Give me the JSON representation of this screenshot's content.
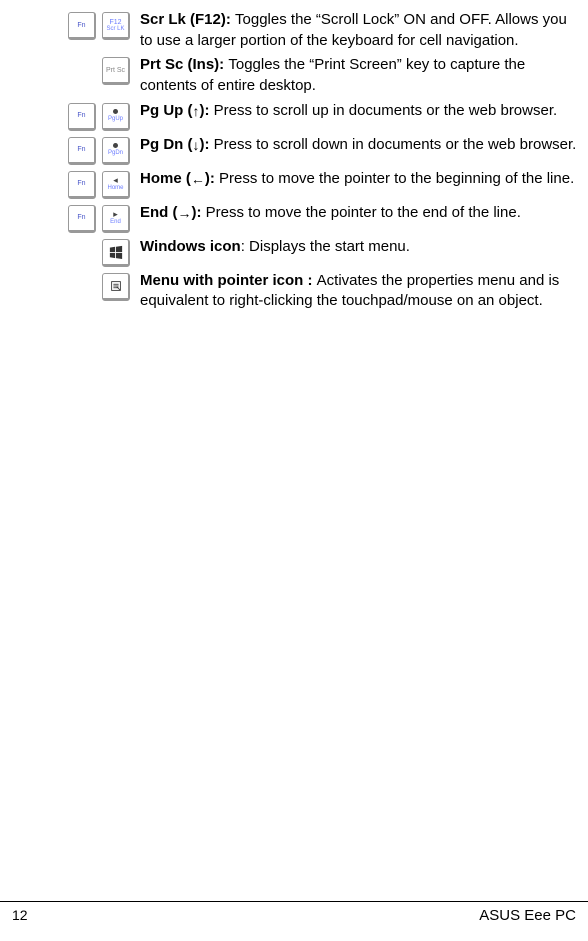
{
  "rows": [
    {
      "title": "Scr Lk (F12): ",
      "desc": "Toggles the “Scroll Lock” ON and OFF. Allows you to use a larger portion of the keyboard for cell navigation."
    },
    {
      "title": "Prt Sc (Ins): ",
      "desc": "Toggles the “Print Screen” key to capture the contents of entire desktop."
    },
    {
      "title_pre": "Pg Up (",
      "arrow": "↑",
      "title_post": "): ",
      "desc": "Press to scroll up in documents or the web browser."
    },
    {
      "title_pre": "Pg Dn (",
      "arrow": "↓",
      "title_post": "): ",
      "desc": "Press to scroll down in documents or the web browser."
    },
    {
      "title_pre": "Home (",
      "arrow": "←",
      "title_post": "): ",
      "desc": "Press to move the pointer to the beginning of the line."
    },
    {
      "title_pre": "End (",
      "arrow": "→",
      "title_post": "): ",
      "desc": "Press to move the pointer to the end of the line."
    },
    {
      "title": "Windows icon",
      "sep": ": ",
      "desc": "Displays the start menu."
    },
    {
      "title": "Menu with pointer icon : ",
      "desc": "Activates the properties menu and is equivalent to right-clicking the touchpad/mouse on an object."
    }
  ],
  "keys": {
    "fn": "Fn",
    "f12": "F12",
    "scrlk": "Scr LK",
    "prtsc": "Prt Sc",
    "pgup": "PgUp",
    "pgdn": "PgDn",
    "home": "Home",
    "end": "End"
  },
  "footer": {
    "page": "12",
    "brand": "ASUS Eee PC"
  }
}
